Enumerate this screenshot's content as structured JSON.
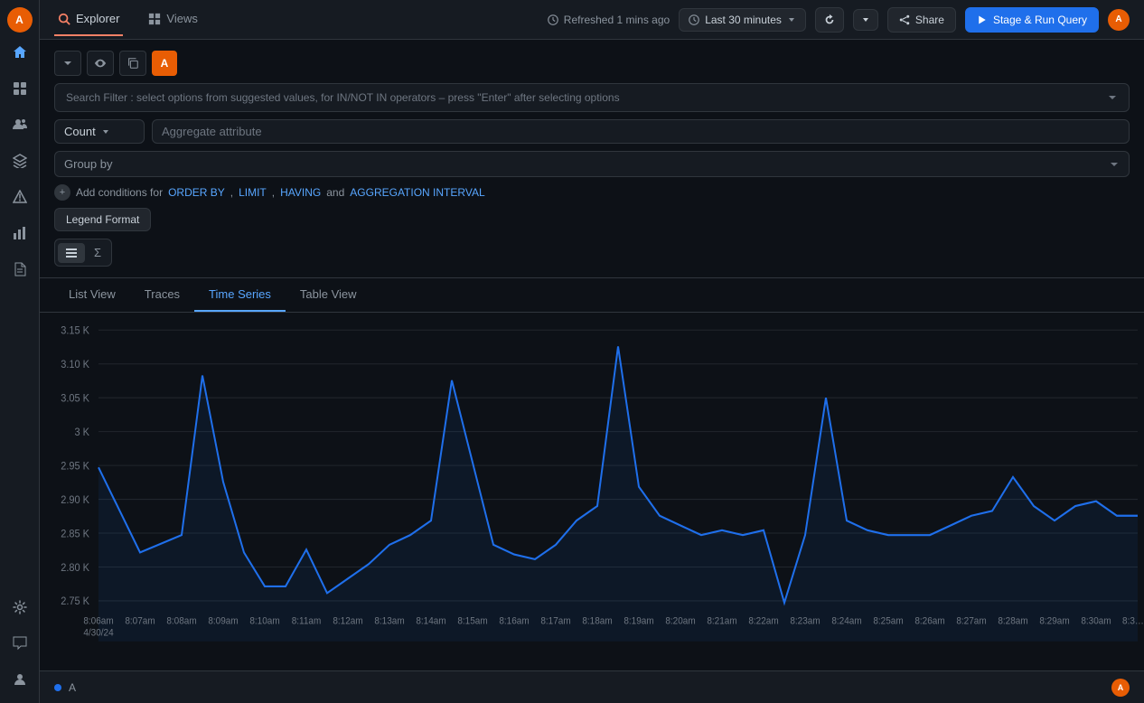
{
  "nav": {
    "tabs": [
      {
        "label": "Explorer",
        "active": true,
        "icon": "🔭"
      },
      {
        "label": "Views",
        "active": false,
        "icon": "📊"
      }
    ]
  },
  "header": {
    "refresh_label": "Refreshed 1 mins ago",
    "bell_icon": "🔔",
    "time_range": "Last 30 minutes",
    "refresh_icon": "↻",
    "caret_icon": "▾",
    "share_label": "Share",
    "run_label": "Stage & Run Query"
  },
  "search": {
    "placeholder": "Search Filter : select options from suggested values, for IN/NOT IN operators – press \"Enter\" after selecting options"
  },
  "filter": {
    "count_label": "Count",
    "agg_placeholder": "Aggregate attribute",
    "group_by_label": "Group by",
    "conditions_prefix": "Add conditions for",
    "order_by_link": "ORDER BY",
    "limit_link": "LIMIT",
    "having_link": "HAVING",
    "and_text": "and",
    "agg_interval_link": "AGGREGATION INTERVAL",
    "legend_format_label": "Legend Format"
  },
  "view_toggle": [
    {
      "icon": "≡",
      "title": "list"
    },
    {
      "icon": "Σ",
      "title": "sum"
    }
  ],
  "tabs": [
    {
      "label": "List View"
    },
    {
      "label": "Traces"
    },
    {
      "label": "Time Series",
      "active": true
    },
    {
      "label": "Table View"
    }
  ],
  "chart": {
    "y_labels": [
      "3.15 K",
      "3.10 K",
      "3.05 K",
      "3 K",
      "2.95 K",
      "2.90 K",
      "2.85 K",
      "2.80 K",
      "2.75 K"
    ],
    "x_labels": [
      "8:06am\n4/30/24",
      "8:07am",
      "8:08am",
      "8:09am",
      "8:10am",
      "8:11am",
      "8:12am",
      "8:13am",
      "8:14am",
      "8:15am",
      "8:16am",
      "8:17am",
      "8:18am",
      "8:19am",
      "8:20am",
      "8:21am",
      "8:22am",
      "8:23am",
      "8:24am",
      "8:25am",
      "8:26am",
      "8:27am",
      "8:28am",
      "8:29am",
      "8:30am",
      "8:3…"
    ]
  },
  "bottom": {
    "legend_label": "A",
    "avatar_label": "A"
  },
  "sidebar_icons": [
    {
      "name": "home",
      "symbol": "⌂"
    },
    {
      "name": "search",
      "symbol": "⊞"
    },
    {
      "name": "users",
      "symbol": "👤"
    },
    {
      "name": "grid",
      "symbol": "⊞"
    },
    {
      "name": "layers",
      "symbol": "◫"
    },
    {
      "name": "alert",
      "symbol": "⚠"
    },
    {
      "name": "chart",
      "symbol": "📈"
    },
    {
      "name": "doc",
      "symbol": "📄"
    },
    {
      "name": "settings",
      "symbol": "⚙"
    },
    {
      "name": "comment",
      "symbol": "💬"
    },
    {
      "name": "person",
      "symbol": "👤"
    }
  ]
}
